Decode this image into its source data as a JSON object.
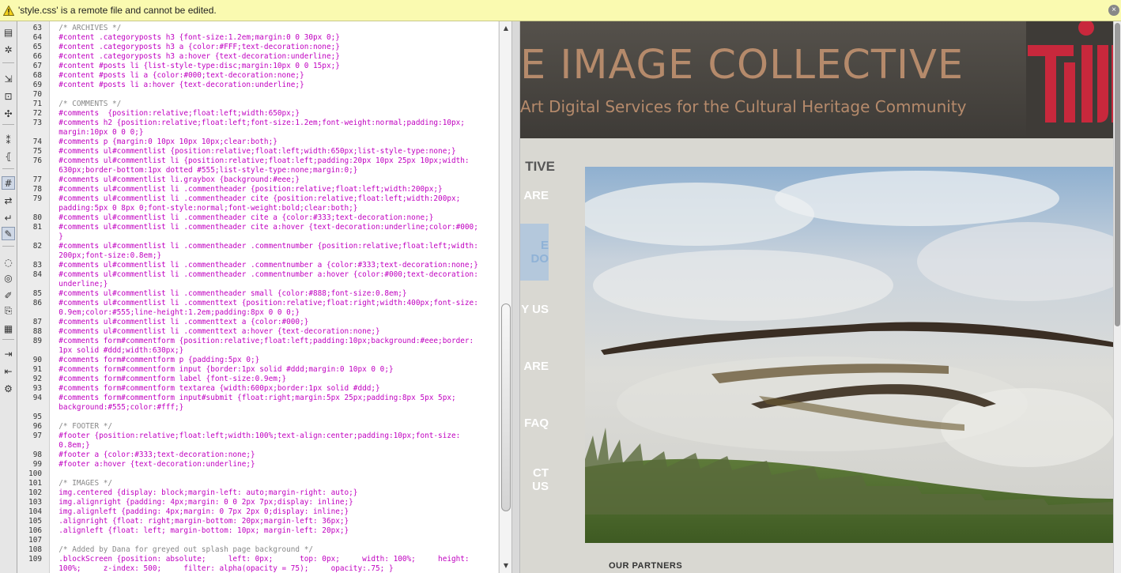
{
  "notification": {
    "message": "'style.css' is a remote file and cannot be edited.",
    "icon": "warning-icon"
  },
  "toolbar": {
    "tools": [
      {
        "name": "file-management-icon",
        "glyph": "▤"
      },
      {
        "name": "settings-gear-icon",
        "glyph": "✲"
      },
      {
        "name": "expand-tags-icon",
        "glyph": "⇲"
      },
      {
        "name": "select-parent-tag-icon",
        "glyph": "⊡"
      },
      {
        "name": "balance-braces-icon",
        "glyph": "✣"
      },
      {
        "name": "line-numbers-icon",
        "glyph": "⁑"
      },
      {
        "name": "highlight-invalid-icon",
        "glyph": "⦃"
      },
      {
        "name": "syntax-coloring-icon",
        "glyph": "#"
      },
      {
        "name": "auto-indent-icon",
        "glyph": "⇄"
      },
      {
        "name": "word-wrap-icon",
        "glyph": "↵"
      },
      {
        "name": "apply-comment-icon",
        "glyph": "✎"
      },
      {
        "name": "remove-comment-icon",
        "glyph": "◌"
      },
      {
        "name": "wrap-tag-icon",
        "glyph": "◎"
      },
      {
        "name": "recent-snippets-icon",
        "glyph": "✐"
      },
      {
        "name": "move-css-icon",
        "glyph": "⎘"
      },
      {
        "name": "format-source-icon",
        "glyph": "▦"
      },
      {
        "name": "indent-code-icon",
        "glyph": "⇥"
      },
      {
        "name": "outdent-code-icon",
        "glyph": "⇤"
      },
      {
        "name": "format-brush-icon",
        "glyph": "⚙"
      }
    ]
  },
  "editor": {
    "lines": [
      {
        "n": "63",
        "t": "  /* ARCHIVES */",
        "c": "com"
      },
      {
        "n": "64",
        "t": "  #content .categoryposts h3 {font-size:1.2em;margin:0 0 30px 0;}",
        "c": "code"
      },
      {
        "n": "65",
        "t": "  #content .categoryposts h3 a {color:#FFF;text-decoration:none;}",
        "c": "code"
      },
      {
        "n": "66",
        "t": "  #content .categoryposts h3 a:hover {text-decoration:underline;}",
        "c": "code"
      },
      {
        "n": "67",
        "t": "  #content #posts li {list-style-type:disc;margin:10px 0 0 15px;}",
        "c": "code"
      },
      {
        "n": "68",
        "t": "  #content #posts li a {color:#000;text-decoration:none;}",
        "c": "code"
      },
      {
        "n": "69",
        "t": "  #content #posts li a:hover {text-decoration:underline;}",
        "c": "code"
      },
      {
        "n": "70",
        "t": "",
        "c": "code"
      },
      {
        "n": "71",
        "t": "  /* COMMENTS */",
        "c": "com"
      },
      {
        "n": "72",
        "t": "  #comments  {position:relative;float:left;width:650px;}",
        "c": "code"
      },
      {
        "n": "73",
        "t": "  #comments h2 {position:relative;float:left;font-size:1.2em;font-weight:normal;padding:10px;",
        "c": "code"
      },
      {
        "n": "",
        "t": "  margin:10px 0 0 0;}",
        "c": "code"
      },
      {
        "n": "74",
        "t": "  #comments p {margin:0 10px 10px 10px;clear:both;}",
        "c": "code"
      },
      {
        "n": "75",
        "t": "  #comments ul#commentlist {position:relative;float:left;width:650px;list-style-type:none;}",
        "c": "code"
      },
      {
        "n": "76",
        "t": "  #comments ul#commentlist li {position:relative;float:left;padding:20px 10px 25px 10px;width:",
        "c": "code"
      },
      {
        "n": "",
        "t": "  630px;border-bottom:1px dotted #555;list-style-type:none;margin:0;}",
        "c": "code"
      },
      {
        "n": "77",
        "t": "  #comments ul#commentlist li.graybox {background:#eee;}",
        "c": "code"
      },
      {
        "n": "78",
        "t": "  #comments ul#commentlist li .commentheader {position:relative;float:left;width:200px;}",
        "c": "code"
      },
      {
        "n": "79",
        "t": "  #comments ul#commentlist li .commentheader cite {position:relative;float:left;width:200px;",
        "c": "code"
      },
      {
        "n": "",
        "t": "  padding:5px 0 8px 0;font-style:normal;font-weight:bold;clear:both;}",
        "c": "code"
      },
      {
        "n": "80",
        "t": "  #comments ul#commentlist li .commentheader cite a {color:#333;text-decoration:none;}",
        "c": "code"
      },
      {
        "n": "81",
        "t": "  #comments ul#commentlist li .commentheader cite a:hover {text-decoration:underline;color:#000;",
        "c": "code"
      },
      {
        "n": "",
        "t": "  }",
        "c": "code"
      },
      {
        "n": "82",
        "t": "  #comments ul#commentlist li .commentheader .commentnumber {position:relative;float:left;width:",
        "c": "code"
      },
      {
        "n": "",
        "t": "  200px;font-size:0.8em;}",
        "c": "code"
      },
      {
        "n": "83",
        "t": "  #comments ul#commentlist li .commentheader .commentnumber a {color:#333;text-decoration:none;}",
        "c": "code"
      },
      {
        "n": "84",
        "t": "  #comments ul#commentlist li .commentheader .commentnumber a:hover {color:#000;text-decoration:",
        "c": "code"
      },
      {
        "n": "",
        "t": "  underline;}",
        "c": "code"
      },
      {
        "n": "85",
        "t": "  #comments ul#commentlist li .commentheader small {color:#888;font-size:0.8em;}",
        "c": "code"
      },
      {
        "n": "86",
        "t": "  #comments ul#commentlist li .commenttext {position:relative;float:right;width:400px;font-size:",
        "c": "code"
      },
      {
        "n": "",
        "t": "  0.9em;color:#555;line-height:1.2em;padding:8px 0 0 0;}",
        "c": "code"
      },
      {
        "n": "87",
        "t": "  #comments ul#commentlist li .commenttext a {color:#000;}",
        "c": "code"
      },
      {
        "n": "88",
        "t": "  #comments ul#commentlist li .commenttext a:hover {text-decoration:none;}",
        "c": "code"
      },
      {
        "n": "89",
        "t": "  #comments form#commentform {position:relative;float:left;padding:10px;background:#eee;border:",
        "c": "code"
      },
      {
        "n": "",
        "t": "  1px solid #ddd;width:630px;}",
        "c": "code"
      },
      {
        "n": "90",
        "t": "  #comments form#commentform p {padding:5px 0;}",
        "c": "code"
      },
      {
        "n": "91",
        "t": "  #comments form#commentform input {border:1px solid #ddd;margin:0 10px 0 0;}",
        "c": "code"
      },
      {
        "n": "92",
        "t": "  #comments form#commentform label {font-size:0.9em;}",
        "c": "code"
      },
      {
        "n": "93",
        "t": "  #comments form#commentform textarea {width:600px;border:1px solid #ddd;}",
        "c": "code"
      },
      {
        "n": "94",
        "t": "  #comments form#commentform input#submit {float:right;margin:5px 25px;padding:8px 5px 5px;",
        "c": "code"
      },
      {
        "n": "",
        "t": "  background:#555;color:#fff;}",
        "c": "code"
      },
      {
        "n": "95",
        "t": "",
        "c": "code"
      },
      {
        "n": "96",
        "t": "  /* FOOTER */",
        "c": "com"
      },
      {
        "n": "97",
        "t": "  #footer {position:relative;float:left;width:100%;text-align:center;padding:10px;font-size:",
        "c": "code"
      },
      {
        "n": "",
        "t": "  0.8em;}",
        "c": "code"
      },
      {
        "n": "98",
        "t": "  #footer a {color:#333;text-decoration:none;}",
        "c": "code"
      },
      {
        "n": "99",
        "t": "  #footer a:hover {text-decoration:underline;}",
        "c": "code"
      },
      {
        "n": "100",
        "t": "",
        "c": "code"
      },
      {
        "n": "101",
        "t": "  /* IMAGES */",
        "c": "com"
      },
      {
        "n": "102",
        "t": "  img.centered {display: block;margin-left: auto;margin-right: auto;}",
        "c": "code"
      },
      {
        "n": "103",
        "t": "  img.alignright {padding: 4px;margin: 0 0 2px 7px;display: inline;}",
        "c": "code"
      },
      {
        "n": "104",
        "t": "  img.alignleft {padding: 4px;margin: 0 7px 2px 0;display: inline;}",
        "c": "code"
      },
      {
        "n": "105",
        "t": "  .alignright {float: right;margin-bottom: 20px;margin-left: 36px;}",
        "c": "code"
      },
      {
        "n": "106",
        "t": "  .alignleft {float: left; margin-bottom: 10px; margin-left: 20px;}",
        "c": "code"
      },
      {
        "n": "107",
        "t": "",
        "c": "code"
      },
      {
        "n": "108",
        "t": "  /* Added by Dana for greyed out splash page background */",
        "c": "com"
      },
      {
        "n": "109",
        "t": "  .blockScreen {position: absolute;     left: 0px;      top: 0px;     width: 100%;     height:",
        "c": "code"
      },
      {
        "n": "",
        "t": "  100%;     z-index: 500;     filter: alpha(opacity = 75);     opacity:.75; }",
        "c": "code"
      }
    ]
  },
  "preview": {
    "site_title": "E IMAGE COLLECTIVE",
    "tagline": "Art Digital Services for the Cultural Heritage Community",
    "nav": [
      "TIVE",
      "ARE",
      "E DO",
      "Y US",
      "ARE",
      "FAQ",
      "CT US"
    ],
    "active_nav_index": 2,
    "partners_heading": "OUR PARTNERS",
    "colors": {
      "header_bg": "#4a4641",
      "title": "#b58a6b",
      "logo_red": "#c8283c",
      "nav_active": "#b4c8dc"
    }
  }
}
